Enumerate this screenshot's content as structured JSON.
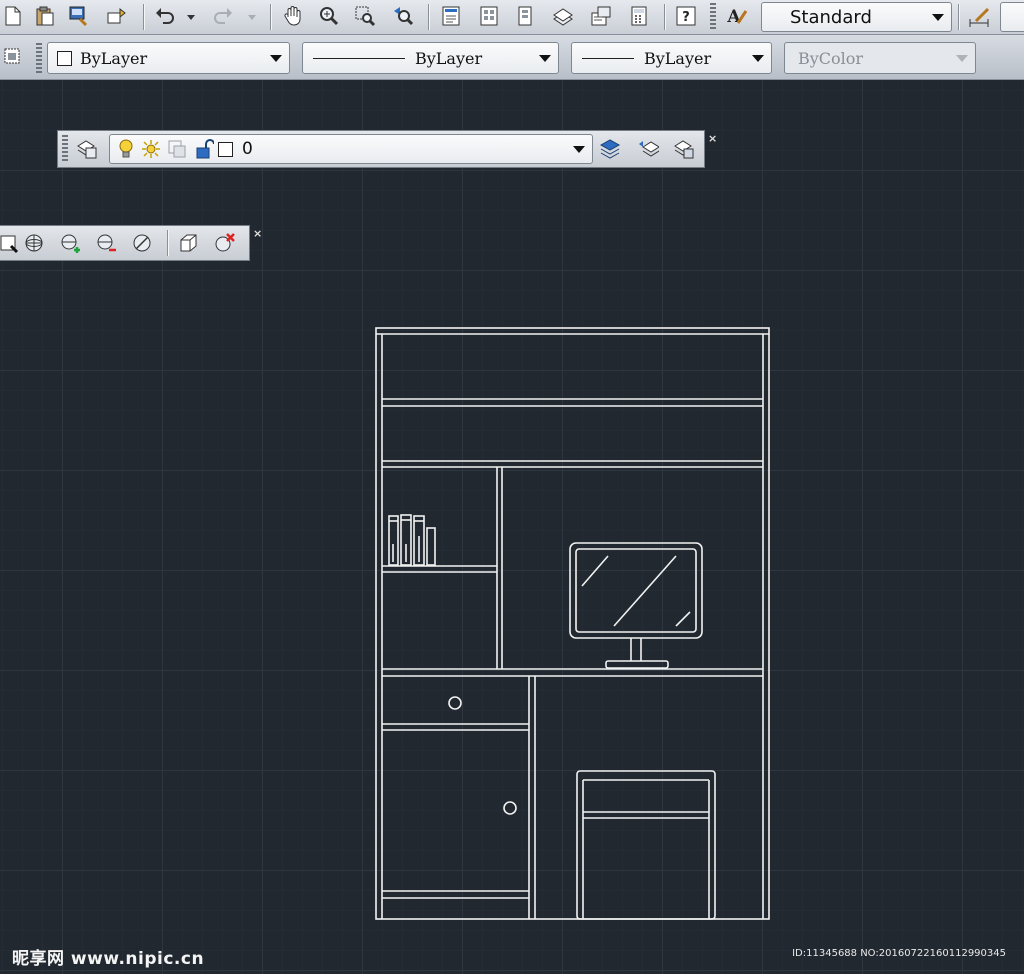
{
  "toolbar_standard": {
    "text_style_value": "Standard",
    "icons": [
      "new-icon",
      "paste-icon",
      "match-properties-icon",
      "block-editor-icon",
      "undo-icon",
      "redo-icon",
      "pan-icon",
      "zoom-realtime-icon",
      "zoom-window-icon",
      "zoom-previous-icon",
      "properties-icon",
      "design-center-icon",
      "tool-palettes-icon",
      "sheet-set-icon",
      "markup-icon",
      "quickcalc-icon",
      "help-icon",
      "text-style-icon",
      "dimension-style-icon"
    ]
  },
  "toolbar_properties": {
    "color_value": "ByLayer",
    "linetype_value": "ByLayer",
    "lineweight_value": "ByLayer",
    "plotstyle_value": "ByColor"
  },
  "layers_toolbar": {
    "current_layer": "0",
    "close_label": "×"
  },
  "view_toolbar": {
    "close_label": "×"
  },
  "watermark": {
    "left": "昵享网 www.nipic.cn",
    "right": "ID:11345688 NO:20160722160112990345"
  },
  "colors": {
    "canvas_bg": "#212830",
    "grid_major": "#2e3640",
    "grid_minor": "#252c35",
    "drawing_line": "#f2f2f2",
    "toolbar_bg": "#dfe3e8"
  }
}
